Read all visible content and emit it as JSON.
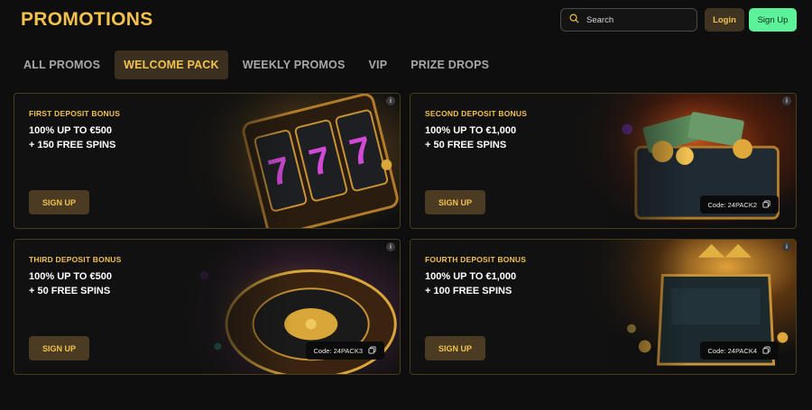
{
  "header": {
    "title": "PROMOTIONS",
    "search_placeholder": "Search",
    "login_label": "Login",
    "signup_label": "Sign Up"
  },
  "tabs": [
    {
      "label": "ALL PROMOS",
      "active": false
    },
    {
      "label": "WELCOME PACK",
      "active": true
    },
    {
      "label": "WEEKLY PROMOS",
      "active": false
    },
    {
      "label": "VIP",
      "active": false
    },
    {
      "label": "PRIZE DROPS",
      "active": false
    }
  ],
  "promos": [
    {
      "label": "FIRST DEPOSIT BONUS",
      "headline": "100% UP TO €500\n+ 150 FREE SPINS",
      "cta": "SIGN UP",
      "code": "",
      "art": "slot-machine"
    },
    {
      "label": "SECOND DEPOSIT BONUS",
      "headline": "100% UP TO €1,000\n+ 50 FREE SPINS",
      "cta": "SIGN UP",
      "code": "Code: 24PACK2",
      "art": "treasure-chest"
    },
    {
      "label": "THIRD DEPOSIT BONUS",
      "headline": "100% UP TO €500\n+ 50 FREE SPINS",
      "cta": "SIGN UP",
      "code": "Code: 24PACK3",
      "art": "roulette-wheel"
    },
    {
      "label": "FOURTH DEPOSIT BONUS",
      "headline": "100% UP TO €1,000\n+ 100 FREE SPINS",
      "cta": "SIGN UP",
      "code": "Code: 24PACK4",
      "art": "throne"
    }
  ],
  "info_icon_label": "i",
  "colors": {
    "accent_gold": "#f2c14e",
    "signup_green": "#5cf29a",
    "background": "#0e0e0f",
    "card_border": "#4a3d1c"
  }
}
